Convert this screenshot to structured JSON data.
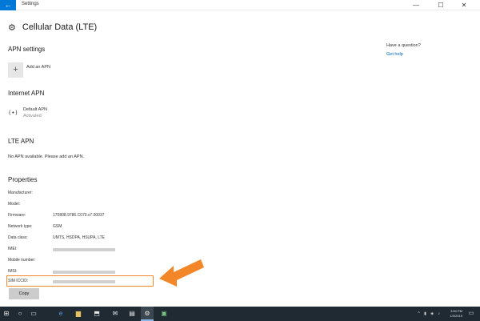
{
  "window": {
    "title": "Settings",
    "controls": [
      "—",
      "☐",
      "✕"
    ]
  },
  "header": {
    "title": "Cellular Data (LTE)",
    "icon": "gear-icon"
  },
  "apn_settings": {
    "title": "APN settings",
    "add_label": "Add an APN"
  },
  "internet_apn": {
    "title": "Internet APN",
    "name": "Default APN",
    "status": "Activated",
    "icon": "(•)"
  },
  "lte_apn": {
    "title": "LTE APN",
    "message": "No APN available. Please add an APN."
  },
  "properties": {
    "title": "Properties",
    "rows": [
      {
        "label": "Manufacturer:",
        "value": ""
      },
      {
        "label": "Model:",
        "value": ""
      },
      {
        "label": "Firmware:",
        "value": "170808.9786.C070.v7.00037"
      },
      {
        "label": "Network type:",
        "value": "GSM"
      },
      {
        "label": "Data class:",
        "value": "UMTS, HSDPA, HSUPA, LTE"
      },
      {
        "label": "IMEI:",
        "value": ""
      },
      {
        "label": "Mobile number:",
        "value": ""
      },
      {
        "label": "IMSI:",
        "value": ""
      },
      {
        "label": "SIM ICCID:",
        "value": ""
      }
    ],
    "copy_label": "Copy"
  },
  "help": {
    "title": "Have a question?",
    "link": "Get help"
  },
  "taskbar": {
    "items": [
      "⊞",
      "○",
      "▭",
      "e",
      "▆",
      "⬒",
      "✉",
      "▤",
      "⚙",
      "▣"
    ],
    "time": "3:50 PM",
    "date": "1/3/2019"
  },
  "colors": {
    "accent": "#0078d7",
    "highlight": "#f4862a",
    "taskbar": "#1f2a33"
  }
}
